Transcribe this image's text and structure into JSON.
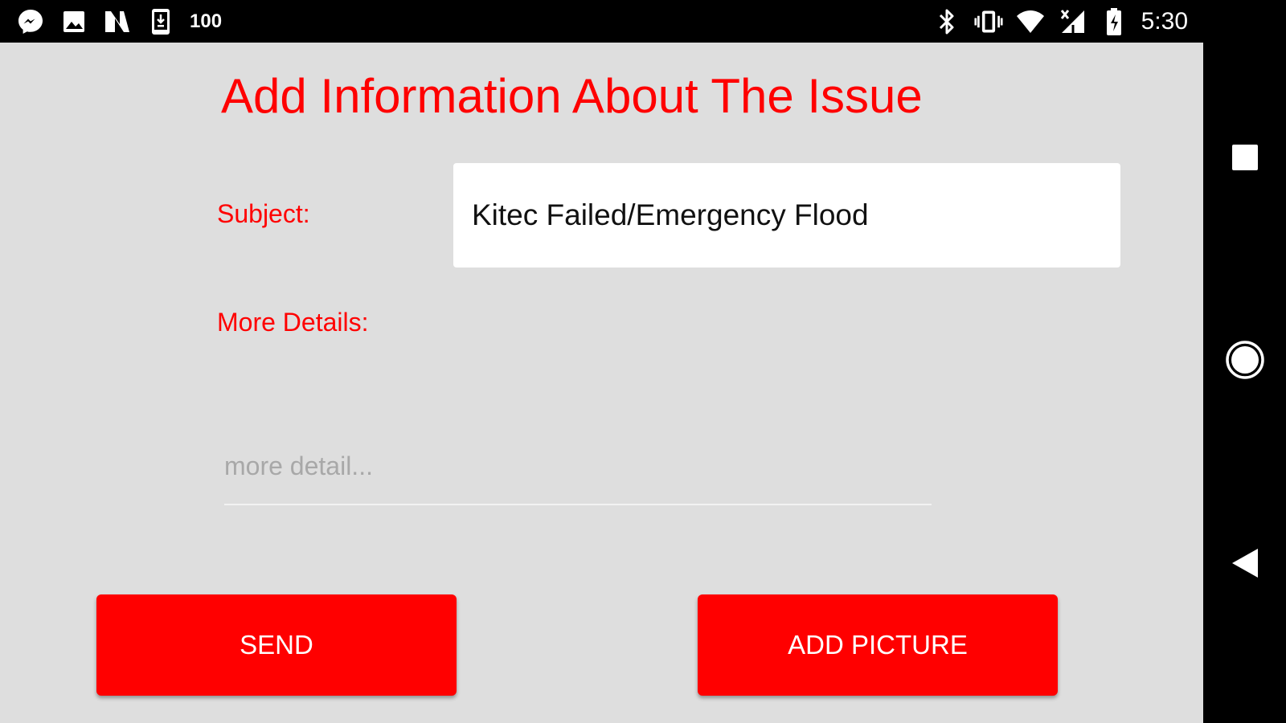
{
  "status_bar": {
    "left_icons": [
      "messenger-icon",
      "image-icon",
      "n-app-icon",
      "download-phone-icon"
    ],
    "badge_text": "100",
    "right_icons": [
      "bluetooth-icon",
      "vibrate-icon",
      "wifi-icon",
      "cell-signal-icon",
      "battery-icon"
    ],
    "time": "5:30"
  },
  "page": {
    "title": "Add Information About The Issue",
    "title_color": "#ff0000",
    "background_color": "#dedede"
  },
  "form": {
    "subject_label": "Subject:",
    "subject_value": "Kitec Failed/Emergency Flood",
    "details_label": "More Details:",
    "details_placeholder": "more detail...",
    "details_value": ""
  },
  "actions": {
    "send_label": "SEND",
    "add_picture_label": "ADD PICTURE",
    "button_color": "#ff0000"
  },
  "nav_bar": {
    "items": [
      "recents-icon",
      "home-icon",
      "back-icon"
    ]
  }
}
